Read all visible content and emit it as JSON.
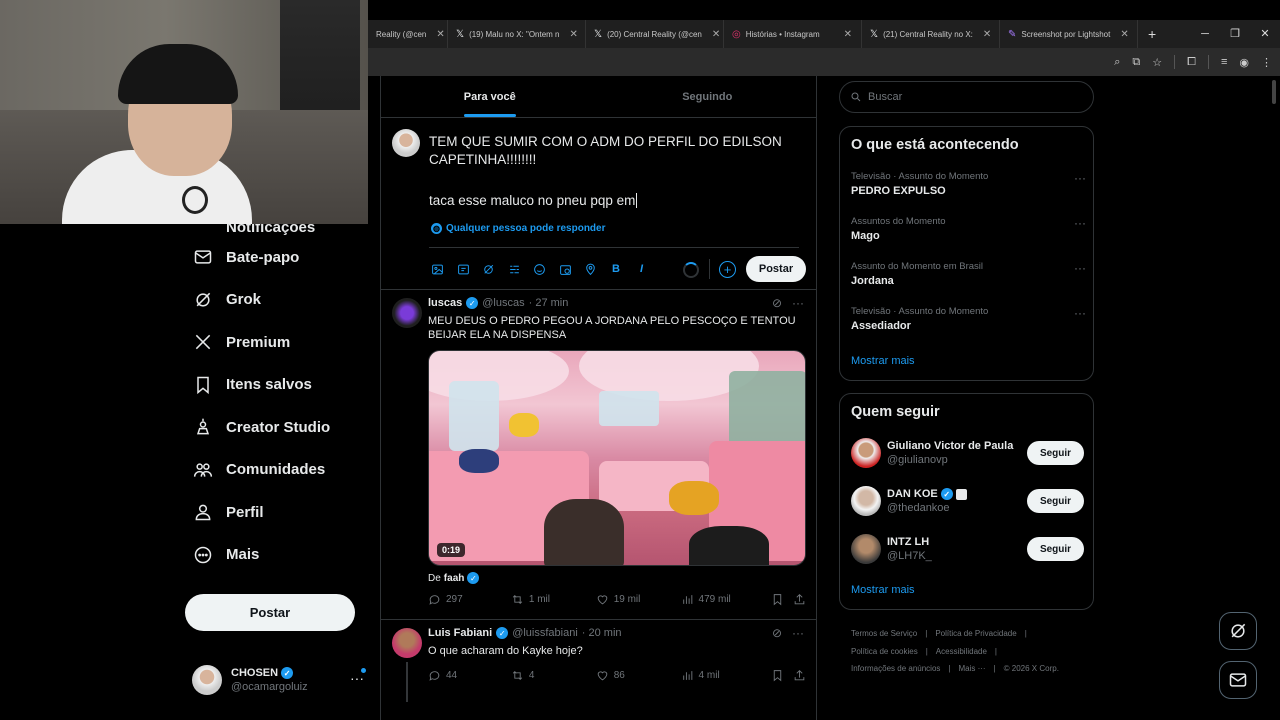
{
  "browser": {
    "tabs": [
      {
        "label": "Reality (@cen",
        "icon": "x-logo-icon"
      },
      {
        "label": "(19) Malu no X: \"Ontem n",
        "icon": "x-logo-icon"
      },
      {
        "label": "(20) Central Reality (@cen",
        "icon": "x-logo-icon"
      },
      {
        "label": "Histórias • Instagram",
        "icon": "instagram-icon"
      },
      {
        "label": "(21) Central Reality no X:",
        "icon": "x-logo-icon"
      },
      {
        "label": "Screenshot por Lightshot",
        "icon": "lightshot-icon"
      }
    ],
    "new_tab": "+",
    "window": {
      "minimize": "─",
      "maximize": "❐",
      "close": "✕"
    }
  },
  "nav": {
    "partial_item": "Notificações",
    "items": [
      {
        "label": "Bate-papo",
        "icon": "mail-icon"
      },
      {
        "label": "Grok",
        "icon": "grok-icon"
      },
      {
        "label": "Premium",
        "icon": "x-logo-icon"
      },
      {
        "label": "Itens salvos",
        "icon": "bookmark-icon"
      },
      {
        "label": "Creator Studio",
        "icon": "creator-studio-icon"
      },
      {
        "label": "Comunidades",
        "icon": "communities-icon"
      },
      {
        "label": "Perfil",
        "icon": "person-icon"
      },
      {
        "label": "Mais",
        "icon": "more-circle-icon"
      }
    ],
    "post_button": "Postar"
  },
  "account": {
    "name": "CHOSEN",
    "handle": "@ocamargoluiz",
    "more": "···"
  },
  "main": {
    "tabs": [
      {
        "label": "Para você",
        "active": true
      },
      {
        "label": "Seguindo",
        "active": false
      }
    ],
    "composer": {
      "line1": "TEM QUE SUMIR COM O ADM DO PERFIL DO EDILSON CAPETINHA!!!!!!!!",
      "line2": "taca esse maluco no pneu pqp em",
      "reply_setting": "Qualquer pessoa pode responder",
      "post_button": "Postar"
    }
  },
  "tweets": [
    {
      "name": "luscas",
      "handle": "@luscas",
      "time": "· 27 min",
      "text": "MEU DEUS O PEDRO PEGOU A JORDANA PELO PESCOÇO E TENTOU BEIJAR ELA NA DISPENSA",
      "video_duration": "0:19",
      "via_prefix": "De",
      "via_name": "faah",
      "replies": "297",
      "reposts": "1 mil",
      "likes": "19 mil",
      "views": "479 mil"
    },
    {
      "name": "Luis Fabiani",
      "handle": "@luissfabiani",
      "time": "· 20 min",
      "text": "O que acharam do Kayke hoje?",
      "replies": "44",
      "reposts": "4",
      "likes": "86",
      "views": "4 mil"
    }
  ],
  "right": {
    "search_placeholder": "Buscar",
    "trends_title": "O que está acontecendo",
    "trends": [
      {
        "context": "Televisão · Assunto do Momento",
        "title": "PEDRO EXPULSO"
      },
      {
        "context": "Assuntos do Momento",
        "title": "Mago"
      },
      {
        "context": "Assunto do Momento em Brasil",
        "title": "Jordana"
      },
      {
        "context": "Televisão · Assunto do Momento",
        "title": "Assediador"
      }
    ],
    "show_more": "Mostrar mais",
    "who_to_follow_title": "Quem seguir",
    "who_to_follow": [
      {
        "name": "Giuliano Victor de Paula",
        "handle": "@giulianovp",
        "button": "Seguir"
      },
      {
        "name": "DAN KOE",
        "handle": "@thedankoe",
        "button": "Seguir"
      },
      {
        "name": "INTZ LH",
        "handle": "@LH7K_",
        "button": "Seguir"
      }
    ],
    "follow_show_more": "Mostrar mais",
    "footer": {
      "terms": "Termos de Serviço",
      "privacy": "Política de Privacidade",
      "cookies": "Política de cookies",
      "accessibility": "Acessibilidade",
      "ads": "Informações de anúncios",
      "more": "Mais ···",
      "copyright": "© 2026 X Corp."
    }
  },
  "colors": {
    "accent": "#1d9bf0",
    "background": "#000000",
    "text": "#e7e9ea",
    "muted": "#71767b",
    "border": "#2f3336"
  }
}
